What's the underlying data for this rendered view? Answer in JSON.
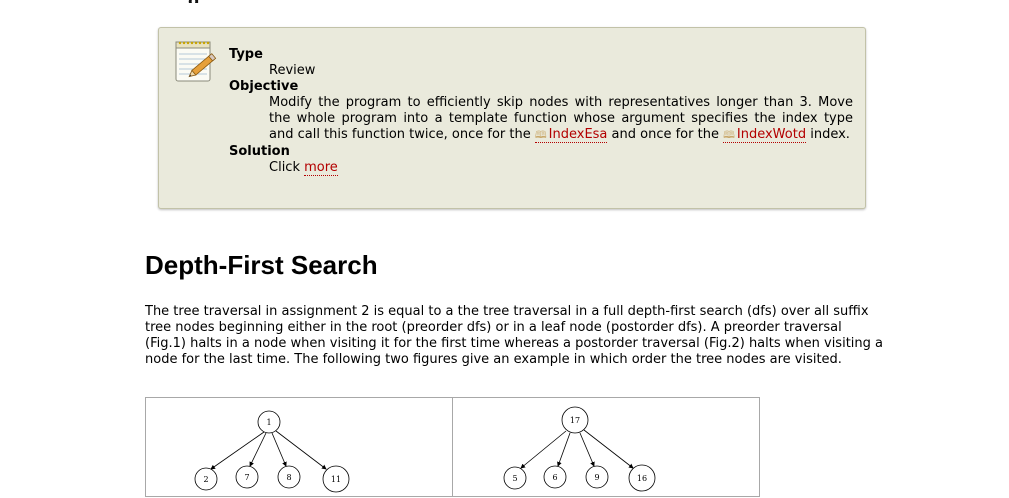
{
  "top_partial_heading": "g",
  "assignment": {
    "icon": "notepad-pencil-icon",
    "type_label": "Type",
    "type_value": "Review",
    "objective_label": "Objective",
    "objective_text_1": "Modify the program to efficiently skip nodes with representatives longer than 3. Move the whole program into a template function whose argument specifies the index type and call this function twice, once for the",
    "index_esa_link": "IndexEsa",
    "objective_text_2": "and once for the",
    "index_wotd_link": "IndexWotd",
    "objective_text_3": "index.",
    "solution_label": "Solution",
    "solution_text": "Click",
    "solution_link": "more"
  },
  "section": {
    "title": "Depth-First Search",
    "body": "The tree traversal in assignment 2 is equal to a the tree traversal in a full depth-first search (dfs) over all suffix tree nodes beginning either in the root (preorder dfs) or in a leaf node (postorder dfs). A preorder traversal (Fig.1) halts in a node when visiting it for the first time whereas a postorder traversal (Fig.2) halts when visiting a node for the last time. The following two figures give an example in which order the tree nodes are visited."
  },
  "figures": {
    "preorder": {
      "root": "1",
      "children": [
        "2",
        "7",
        "8",
        "11"
      ]
    },
    "postorder": {
      "root": "17",
      "children": [
        "5",
        "6",
        "9",
        "16"
      ]
    }
  },
  "colors": {
    "box_background": "#eaeadc",
    "link": "#b30000"
  }
}
